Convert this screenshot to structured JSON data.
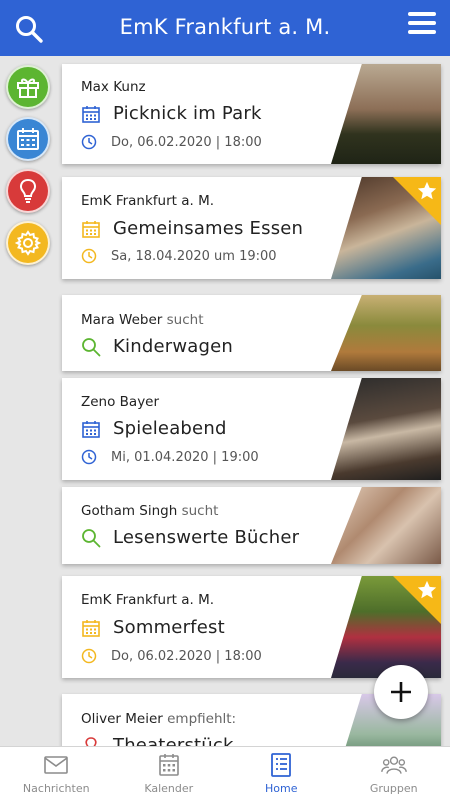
{
  "header": {
    "title": "EmK Frankfurt a. M."
  },
  "side_buttons": [
    {
      "name": "gift",
      "color": "#5cb531"
    },
    {
      "name": "calendar",
      "color": "#3a86d4"
    },
    {
      "name": "idea",
      "color": "#d83a3a"
    },
    {
      "name": "settings",
      "color": "#f3b820"
    }
  ],
  "cards": [
    {
      "author": "Max Kunz",
      "verb": "",
      "type": "event",
      "title": "Picknick im Park",
      "date": "Do, 06.02.2020 | 18:00",
      "accent": "#2f63d4",
      "starred": false
    },
    {
      "author": "EmK Frankfurt a. M.",
      "verb": "",
      "type": "event",
      "title": "Gemeinsames Essen",
      "date": "Sa, 18.04.2020 um 19:00",
      "accent": "#f3b820",
      "starred": true
    },
    {
      "author": "Mara Weber",
      "verb": "sucht",
      "type": "search",
      "title": "Kinderwagen",
      "accent": "#5cb531",
      "starred": false
    },
    {
      "author": "Zeno Bayer",
      "verb": "",
      "type": "event",
      "title": "Spieleabend",
      "date": "Mi, 01.04.2020 | 19:00",
      "accent": "#2f63d4",
      "starred": false
    },
    {
      "author": "Gotham Singh",
      "verb": "sucht",
      "type": "search",
      "title": "Lesenswerte Bücher",
      "accent": "#5cb531",
      "starred": false
    },
    {
      "author": "EmK Frankfurt a. M.",
      "verb": "",
      "type": "event",
      "title": "Sommerfest",
      "date": "Do, 06.02.2020 | 18:00",
      "accent": "#f3b820",
      "starred": true
    },
    {
      "author": "Oliver Meier",
      "verb": "empfiehlt:",
      "type": "recommend",
      "title": "Theaterstück",
      "accent": "#d83a3a",
      "starred": false
    }
  ],
  "nav": [
    {
      "label": "Nachrichten",
      "icon": "mail-icon",
      "active": false
    },
    {
      "label": "Kalender",
      "icon": "calendar-icon",
      "active": false
    },
    {
      "label": "Home",
      "icon": "list-icon",
      "active": true
    },
    {
      "label": "Gruppen",
      "icon": "group-icon",
      "active": false
    }
  ],
  "colors": {
    "primary": "#2f63d4",
    "star": "#f6b817"
  }
}
